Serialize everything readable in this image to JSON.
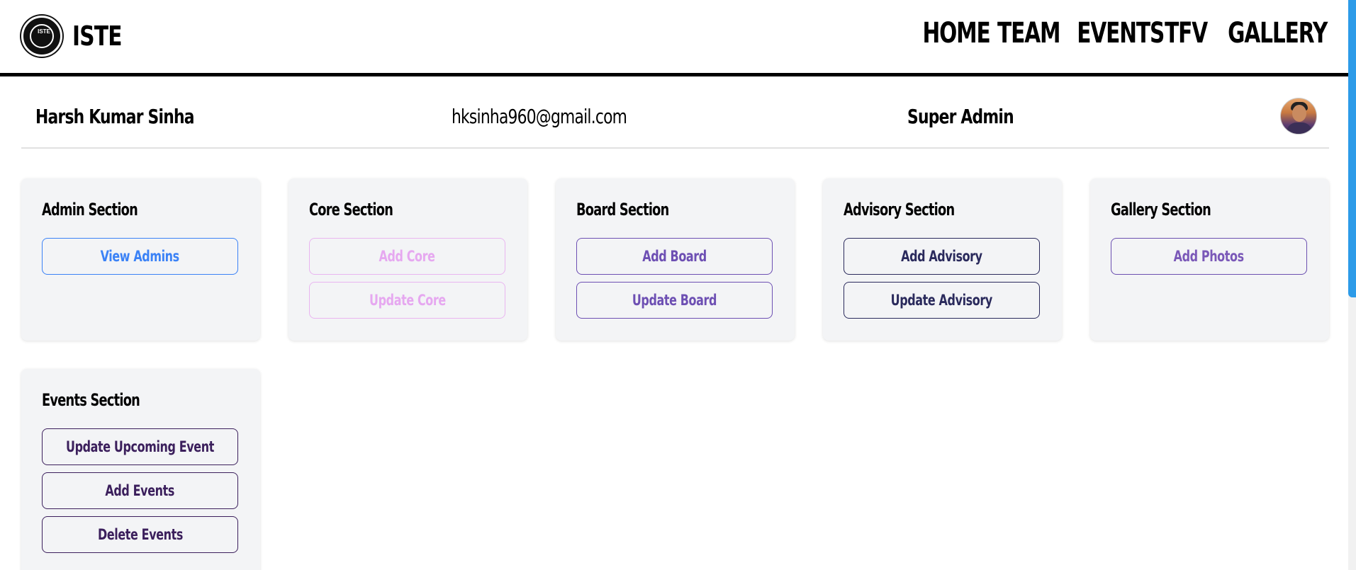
{
  "brand": {
    "name": "ISTE",
    "logo_text": "ISTE"
  },
  "nav": [
    "HOME",
    "TEAM",
    "EVENTS",
    "TFV",
    "GALLERY"
  ],
  "profile": {
    "name": "Harsh Kumar Sinha",
    "email": "hksinha960@gmail.com",
    "role": "Super Admin"
  },
  "sections": {
    "admin": {
      "title": "Admin Section",
      "buttons": [
        "View Admins"
      ]
    },
    "core": {
      "title": "Core Section",
      "buttons": [
        "Add Core",
        "Update Core"
      ]
    },
    "board": {
      "title": "Board Section",
      "buttons": [
        "Add Board",
        "Update Board"
      ]
    },
    "advisory": {
      "title": "Advisory Section",
      "buttons": [
        "Add Advisory",
        "Update Advisory"
      ]
    },
    "gallery": {
      "title": "Gallery Section",
      "buttons": [
        "Add Photos"
      ]
    },
    "events": {
      "title": "Events Section",
      "buttons": [
        "Update Upcoming Event",
        "Add Events",
        "Delete Events"
      ]
    }
  },
  "colors": {
    "nav_border": "#000000",
    "card_bg": "#f3f4f6",
    "admin_btn": "#3b82f6",
    "core_btn": "#e6a8f0",
    "board_btn": "#6d4fb3",
    "advisory_btn": "#2a2a5c",
    "gallery_btn": "#7a58b8",
    "events_btn": "#3b1f5c",
    "scrollbar": "#2d9be8"
  }
}
